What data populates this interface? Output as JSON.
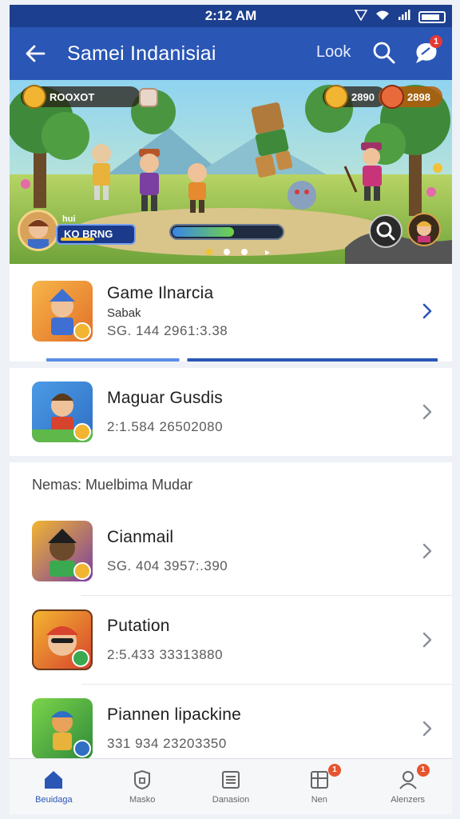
{
  "status_bar": {
    "time": "2:12 AM"
  },
  "app_bar": {
    "title": "Samei Indanisiai",
    "look_label": "Look"
  },
  "chat_badge_count": "1",
  "banner": {
    "hud_left_label": "ROOXOT",
    "hud_right_value_1": "2890",
    "hud_right_value_2": "2898",
    "player_label": "hui",
    "player_name": "KO BRNG",
    "xp_level_fraction": 0.55,
    "page_dots": 3,
    "active_dot": 0
  },
  "list": {
    "featured": [
      {
        "title": "Game Ilnarcia",
        "subtitle": "Sabak",
        "meta": "SG. 144 2961:3.38",
        "accent": "#f28c2a"
      },
      {
        "title": "Maguar Gusdis",
        "subtitle": "",
        "meta": "2:1.584 26502080",
        "accent": "#3c8bd9"
      }
    ],
    "section_title": "Nemas: Muelbima Mudar",
    "items": [
      {
        "title": "Cianmail",
        "meta": "SG. 404 3957:.390",
        "accent": "#6a3fa0"
      },
      {
        "title": "Putation",
        "meta": "2:5.433 33313880",
        "accent": "#d8432e"
      },
      {
        "title": "Piannen lipackine",
        "meta": "331 934 23203350",
        "accent": "#3aa94f"
      }
    ]
  },
  "bottom_nav": [
    {
      "label": "Beuidaga",
      "icon": "home-icon",
      "badge": ""
    },
    {
      "label": "Masko",
      "icon": "shield-icon",
      "badge": ""
    },
    {
      "label": "Danasion",
      "icon": "list-icon",
      "badge": ""
    },
    {
      "label": "Nen",
      "icon": "grid-icon",
      "badge": "1"
    },
    {
      "label": "Alenzers",
      "icon": "user-icon",
      "badge": "1"
    }
  ],
  "colors": {
    "primary": "#2a56b5",
    "status_bar": "#1c3f8f",
    "badge": "#e8542f"
  }
}
